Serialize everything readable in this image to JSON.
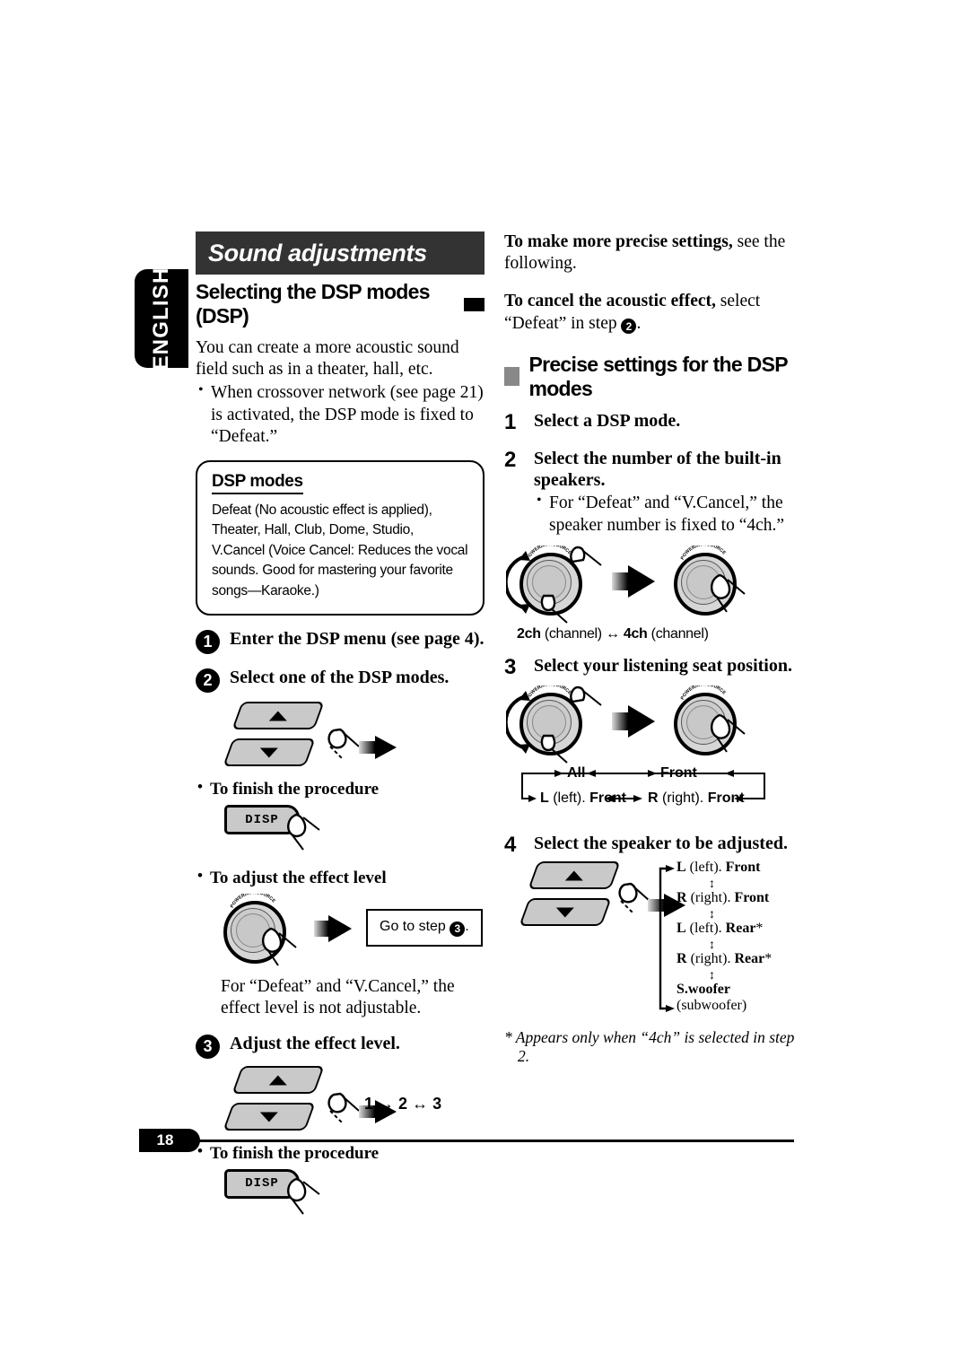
{
  "language_tab": "ENGLISH",
  "page_number": "18",
  "left_column": {
    "banner_title": "Sound adjustments",
    "section_heading": "Selecting the DSP modes (DSP)",
    "intro": "You can create a more acoustic sound field such as in a theater, hall, etc.",
    "intro_bullets": [
      "When crossover network (see page 21) is activated, the DSP mode is fixed to “Defeat.”"
    ],
    "dsp_modes_box": {
      "title": "DSP modes",
      "body": "Defeat (No acoustic effect is applied), Theater, Hall, Club, Dome, Studio, V.Cancel (Voice Cancel: Reduces the vocal sounds. Good for mastering your favorite songs—Karaoke.)"
    },
    "steps": [
      {
        "number": "1",
        "text": "Enter the DSP menu (see page 4)."
      },
      {
        "number": "2",
        "text": "Select one of the DSP modes."
      }
    ],
    "finish_label_1": "To finish the procedure",
    "disp_button_1": "DISP",
    "adjust_effect_label": "To adjust the effect level",
    "goto_step_text_a": "Go to step",
    "goto_step_num": "3",
    "goto_step_text_b": ".",
    "effect_note": "For “Defeat” and “V.Cancel,” the effect level is not adjustable.",
    "step3": {
      "number": "3",
      "text": "Adjust the effect level."
    },
    "level_chain": [
      "1",
      "2",
      "3"
    ],
    "finish_label_2": "To finish the procedure",
    "disp_button_2": "DISP",
    "knob_label": "POWER/ATT/SOURCE"
  },
  "right_column": {
    "note1_bold": "To make more precise settings,",
    "note1_rest": " see the following.",
    "note2_bold": "To cancel the acoustic effect,",
    "note2_rest": " select “Defeat” in step ",
    "note2_step": "2",
    "note2_end": ".",
    "precise_heading": "Precise settings for the DSP modes",
    "step1": {
      "number": "1",
      "text": "Select a DSP mode."
    },
    "step2": {
      "number": "2",
      "text": "Select the number of the built-in speakers.",
      "bullet": "For “Defeat” and “V.Cancel,” the speaker number is fixed to “4ch.”"
    },
    "channel_chain": {
      "left_bold": "2ch",
      "left_rest": " (channel)",
      "right_bold": "4ch",
      "right_rest": " (channel)"
    },
    "step3": {
      "number": "3",
      "text": "Select your listening seat position."
    },
    "seat_positions": {
      "all": "All",
      "front": "Front",
      "l_front_a": "L",
      "l_front_b": " (left). ",
      "l_front_c": "Front",
      "r_front_a": "R",
      "r_front_b": " (right). ",
      "r_front_c": "Front"
    },
    "step4": {
      "number": "4",
      "text": "Select the speaker to be adjusted."
    },
    "speaker_chain": [
      {
        "a": "L",
        "b": " (left). ",
        "c": "Front",
        "star": ""
      },
      {
        "a": "R",
        "b": " (right). ",
        "c": "Front",
        "star": ""
      },
      {
        "a": "L",
        "b": " (left). ",
        "c": "Rear",
        "star": "*"
      },
      {
        "a": "R",
        "b": " (right). ",
        "c": "Rear",
        "star": "*"
      },
      {
        "a": "S.woofer",
        "b": " (subwoofer)",
        "c": "",
        "star": ""
      }
    ],
    "footnote": "* Appears only when “4ch” is selected in step 2.",
    "knob_label": "POWER/ATT/SOURCE"
  }
}
